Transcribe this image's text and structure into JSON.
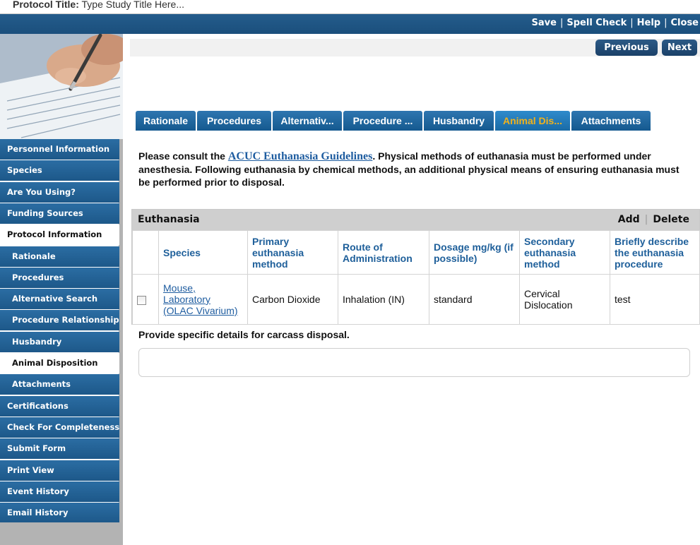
{
  "page": {
    "title_label": "Protocol Title:",
    "title_value": "Type Study Title Here..."
  },
  "header": {
    "links": [
      "Save",
      "Spell Check",
      "Help",
      "Close"
    ]
  },
  "pager": {
    "previous": "Previous",
    "next": "Next"
  },
  "sidebar": {
    "items": [
      {
        "label": "Personnel Information",
        "level": 0,
        "style": "blue"
      },
      {
        "label": "Species",
        "level": 0,
        "style": "blue"
      },
      {
        "label": "Are You Using?",
        "level": 0,
        "style": "blue"
      },
      {
        "label": "Funding Sources",
        "level": 0,
        "style": "blue"
      },
      {
        "label": "Protocol Information",
        "level": 0,
        "style": "white"
      },
      {
        "label": "Rationale",
        "level": 1,
        "style": "blue"
      },
      {
        "label": "Procedures",
        "level": 1,
        "style": "blue"
      },
      {
        "label": "Alternative Search",
        "level": 1,
        "style": "blue"
      },
      {
        "label": "Procedure Relationships",
        "level": 1,
        "style": "blue"
      },
      {
        "label": "Husbandry",
        "level": 1,
        "style": "blue"
      },
      {
        "label": "Animal Disposition",
        "level": 1,
        "style": "white"
      },
      {
        "label": "Attachments",
        "level": 1,
        "style": "blue"
      },
      {
        "label": "Certifications",
        "level": 0,
        "style": "blue"
      },
      {
        "label": "Check For Completeness",
        "level": 0,
        "style": "blue"
      },
      {
        "label": "Submit Form",
        "level": 0,
        "style": "blue"
      },
      {
        "label": "Print View",
        "level": 0,
        "style": "blue"
      },
      {
        "label": "Event History",
        "level": 0,
        "style": "blue"
      },
      {
        "label": "Email History",
        "level": 0,
        "style": "blue"
      }
    ]
  },
  "tabs": [
    {
      "label": "Rationale",
      "active": false
    },
    {
      "label": "Procedures",
      "active": false
    },
    {
      "label": "Alternativ...",
      "active": false
    },
    {
      "label": "Procedure ...",
      "active": false
    },
    {
      "label": "Husbandry",
      "active": false
    },
    {
      "label": "Animal Dis...",
      "active": true
    },
    {
      "label": "Attachments",
      "active": false
    }
  ],
  "intro": {
    "prefix": "Please consult the ",
    "link": "ACUC Euthanasia Guidelines",
    "suffix": ". Physical methods of euthanasia must be performed under anesthesia. Following euthanasia by chemical methods, an additional physical means of ensuring euthanasia must be performed prior to disposal."
  },
  "euthanasia": {
    "title": "Euthanasia",
    "add": "Add",
    "delete": "Delete",
    "columns": [
      "Species",
      "Primary euthanasia method",
      "Route of Administration",
      "Dosage mg/kg (if possible)",
      "Secondary euthanasia method",
      "Briefly describe the euthanasia procedure"
    ],
    "rows": [
      {
        "checked": false,
        "species": "Mouse, Laboratory (OLAC Vivarium)",
        "primary": "Carbon Dioxide",
        "route": "Inhalation (IN)",
        "dosage": "standard",
        "secondary": "Cervical Dislocation",
        "description": "test"
      }
    ]
  },
  "carcass": {
    "label": "Provide specific details for carcass disposal.",
    "value": ""
  },
  "colors": {
    "header_blue": "#1b4f7c",
    "tab_blue": "#15598f",
    "active_tab_text": "#f2b21b",
    "link_blue": "#1f5da0",
    "column_header_text": "#1e5f9a"
  }
}
